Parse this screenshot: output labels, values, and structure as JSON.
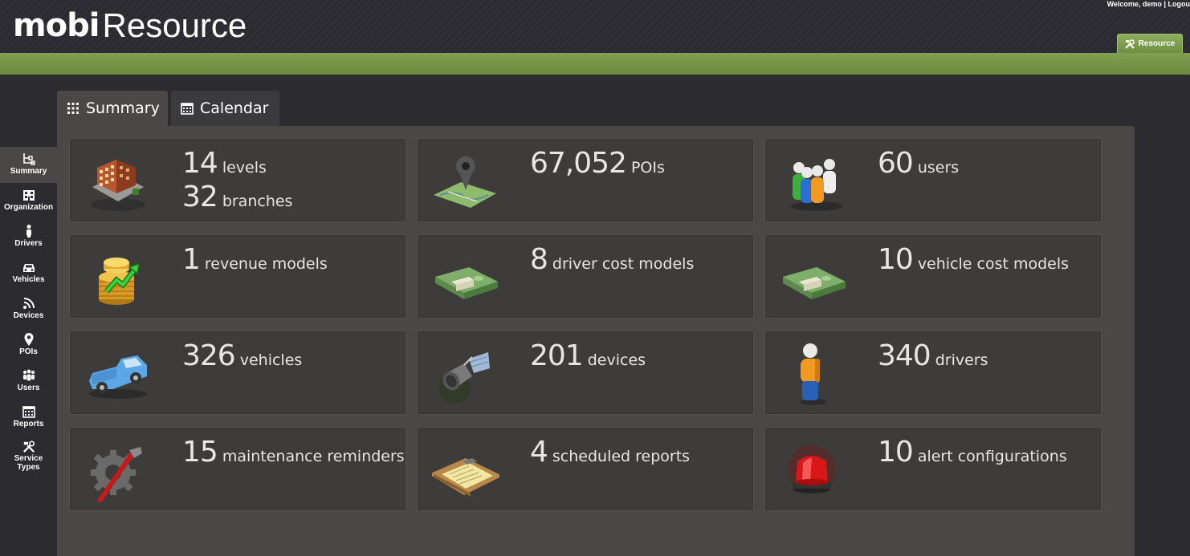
{
  "header": {
    "logo_mobi": "mobi",
    "logo_resource": "Resource",
    "welcome_text": "Welcome, demo",
    "separator": "|",
    "logout": "Logou",
    "resource_tab": "Resource"
  },
  "tabs": [
    {
      "label": "Summary",
      "icon": "grid-icon"
    },
    {
      "label": "Calendar",
      "icon": "calendar-icon"
    }
  ],
  "sidebar": {
    "items": [
      {
        "label": "Summary",
        "icon": "tree-icon"
      },
      {
        "label": "Organization",
        "icon": "building-icon"
      },
      {
        "label": "Drivers",
        "icon": "person-icon"
      },
      {
        "label": "Vehicles",
        "icon": "car-icon"
      },
      {
        "label": "Devices",
        "icon": "signal-icon"
      },
      {
        "label": "POIs",
        "icon": "map-pin-icon"
      },
      {
        "label": "Users",
        "icon": "users-icon"
      },
      {
        "label": "Reports",
        "icon": "calendar-icon"
      },
      {
        "label": "Service",
        "label2": "Types",
        "icon": "tools-icon"
      }
    ]
  },
  "cards": [
    {
      "icon": "building-icon",
      "lines": [
        {
          "num": "14",
          "label": "levels"
        },
        {
          "num": "32",
          "label": "branches"
        }
      ]
    },
    {
      "icon": "map-pin-icon",
      "lines": [
        {
          "num": "67,052",
          "label": "POIs"
        }
      ]
    },
    {
      "icon": "users-icon",
      "lines": [
        {
          "num": "60",
          "label": "users"
        }
      ]
    },
    {
      "icon": "coins-icon",
      "lines": [
        {
          "num": "1",
          "label": "revenue models"
        }
      ]
    },
    {
      "icon": "money-icon",
      "lines": [
        {
          "num": "8",
          "label": "driver cost models"
        }
      ]
    },
    {
      "icon": "money-icon",
      "lines": [
        {
          "num": "10",
          "label": "vehicle cost models"
        }
      ]
    },
    {
      "icon": "truck-icon",
      "lines": [
        {
          "num": "326",
          "label": "vehicles"
        }
      ]
    },
    {
      "icon": "satellite-icon",
      "lines": [
        {
          "num": "201",
          "label": "devices"
        }
      ]
    },
    {
      "icon": "driver-icon",
      "lines": [
        {
          "num": "340",
          "label": "drivers"
        }
      ]
    },
    {
      "icon": "gear-wrench-icon",
      "lines": [
        {
          "num": "15",
          "label": "maintenance reminders"
        }
      ]
    },
    {
      "icon": "clipboard-icon",
      "lines": [
        {
          "num": "4",
          "label": "scheduled reports"
        }
      ]
    },
    {
      "icon": "siren-icon",
      "lines": [
        {
          "num": "10",
          "label": "alert configurations"
        }
      ]
    }
  ]
}
